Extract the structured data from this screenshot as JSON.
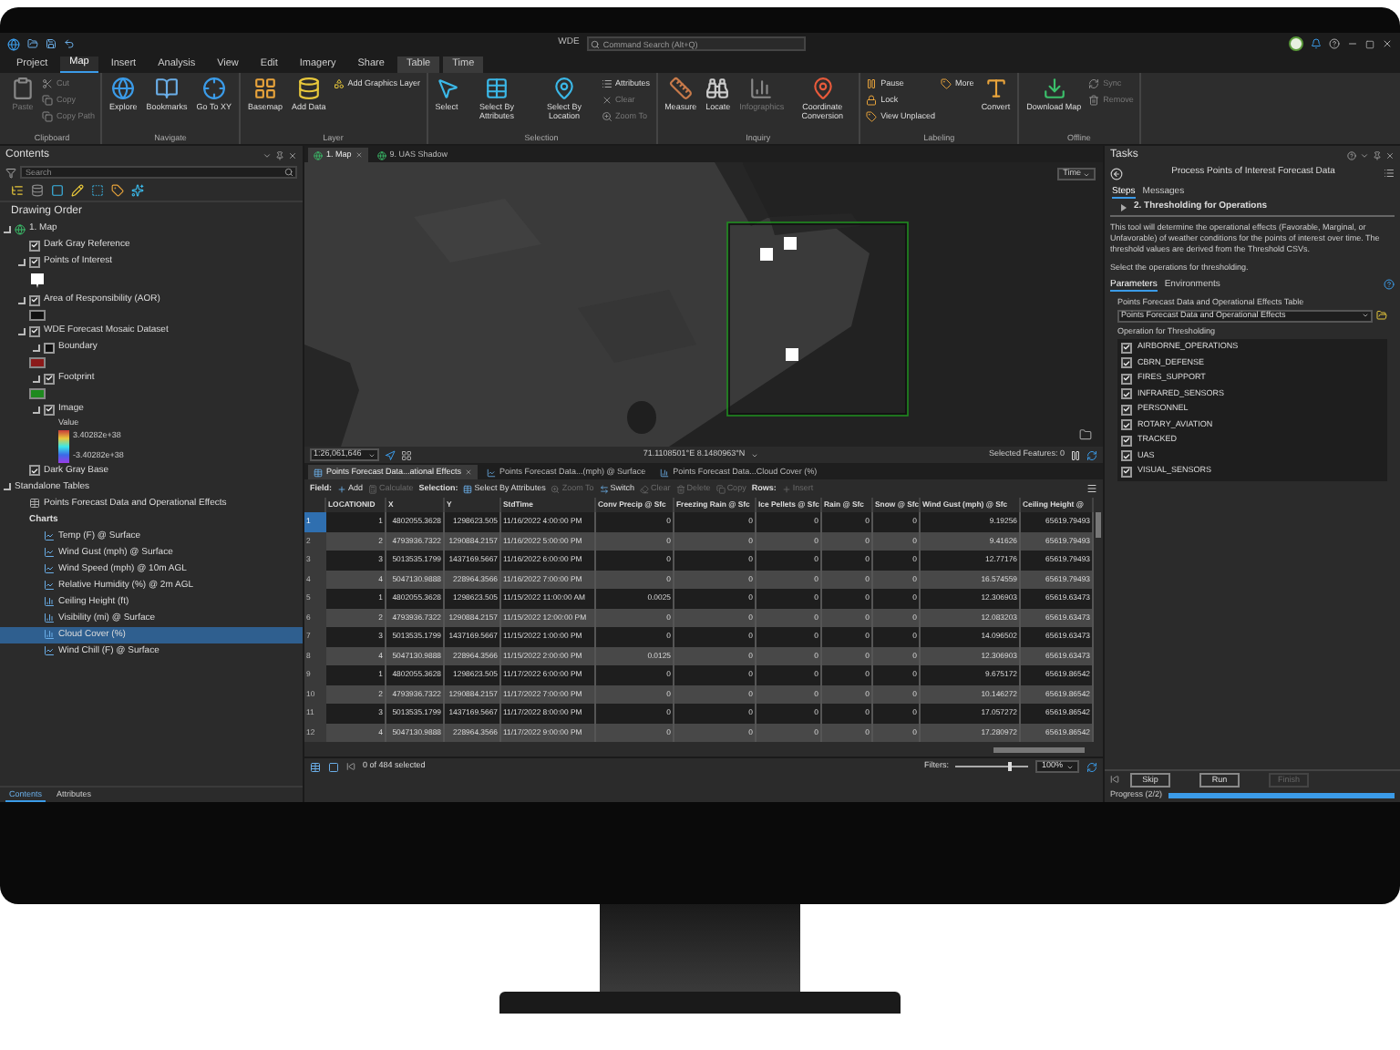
{
  "title_bar": {
    "app_title": "WDE",
    "search_placeholder": "Command Search (Alt+Q)"
  },
  "ribbon_tabs": [
    {
      "label": "Project",
      "selected": false,
      "kind": "plain"
    },
    {
      "label": "Map",
      "selected": true,
      "kind": "plain"
    },
    {
      "label": "Insert",
      "selected": false,
      "kind": "plain"
    },
    {
      "label": "Analysis",
      "selected": false,
      "kind": "plain"
    },
    {
      "label": "View",
      "selected": false,
      "kind": "plain"
    },
    {
      "label": "Edit",
      "selected": false,
      "kind": "plain"
    },
    {
      "label": "Imagery",
      "selected": false,
      "kind": "plain"
    },
    {
      "label": "Share",
      "selected": false,
      "kind": "plain"
    },
    {
      "label": "Table",
      "selected": false,
      "kind": "contextual"
    },
    {
      "label": "Time",
      "selected": false,
      "kind": "contextual"
    }
  ],
  "ribbon_groups": [
    {
      "title": "Clipboard",
      "items": [
        {
          "label": "Paste",
          "kind": "large",
          "disabled": true
        },
        {
          "label": "Cut",
          "kind": "small",
          "disabled": true
        },
        {
          "label": "Copy",
          "kind": "small",
          "disabled": true
        },
        {
          "label": "Copy Path",
          "kind": "small",
          "disabled": true
        }
      ]
    },
    {
      "title": "Navigate",
      "items": [
        {
          "label": "Explore",
          "kind": "large",
          "disabled": false
        },
        {
          "label": "Bookmarks",
          "kind": "large",
          "disabled": false
        },
        {
          "label": "Go To XY",
          "kind": "large",
          "disabled": false
        }
      ]
    },
    {
      "title": "Layer",
      "items": [
        {
          "label": "Basemap",
          "kind": "large",
          "disabled": false
        },
        {
          "label": "Add Data",
          "kind": "large",
          "disabled": false
        },
        {
          "label": "Add Graphics Layer",
          "kind": "small",
          "disabled": false
        }
      ]
    },
    {
      "title": "Selection",
      "items": [
        {
          "label": "Select",
          "kind": "large",
          "disabled": false
        },
        {
          "label": "Select By Attributes",
          "kind": "large",
          "disabled": false
        },
        {
          "label": "Select By Location",
          "kind": "large",
          "disabled": false
        },
        {
          "label": "Attributes",
          "kind": "small",
          "disabled": false
        },
        {
          "label": "Clear",
          "kind": "small",
          "disabled": true
        },
        {
          "label": "Zoom To",
          "kind": "small",
          "disabled": true
        }
      ]
    },
    {
      "title": "Inquiry",
      "items": [
        {
          "label": "Measure",
          "kind": "large",
          "disabled": false
        },
        {
          "label": "Locate",
          "kind": "large",
          "disabled": false
        },
        {
          "label": "Infographics",
          "kind": "large",
          "disabled": true
        },
        {
          "label": "Coordinate Conversion",
          "kind": "large",
          "disabled": false
        }
      ]
    },
    {
      "title": "Labeling",
      "items": [
        {
          "label": "Pause",
          "kind": "small",
          "disabled": false
        },
        {
          "label": "Lock",
          "kind": "small",
          "disabled": false
        },
        {
          "label": "View Unplaced",
          "kind": "small",
          "disabled": false
        },
        {
          "label": "More",
          "kind": "small",
          "disabled": false
        },
        {
          "label": "Convert",
          "kind": "large",
          "disabled": false
        }
      ]
    },
    {
      "title": "Offline",
      "items": [
        {
          "label": "Download Map",
          "kind": "large",
          "disabled": false
        },
        {
          "label": "Sync",
          "kind": "small",
          "disabled": true
        },
        {
          "label": "Remove",
          "kind": "small",
          "disabled": true
        }
      ]
    }
  ],
  "contents": {
    "title": "Contents",
    "search_placeholder": "Search",
    "heading": "Drawing Order",
    "items": [
      {
        "kind": "map",
        "label": "1. Map",
        "expanded": true,
        "children": [
          {
            "kind": "layer",
            "label": "Dark Gray Reference",
            "checked": true
          },
          {
            "kind": "layer",
            "label": "Points of Interest",
            "checked": true,
            "expanded": true,
            "symbol": {
              "kind": "marker"
            }
          },
          {
            "kind": "layer",
            "label": "Area of Responsibility (AOR)",
            "checked": true,
            "expanded": true,
            "symbol": {
              "kind": "box",
              "color": "#111111"
            }
          },
          {
            "kind": "layer",
            "label": "WDE Forecast Mosaic Dataset",
            "checked": true,
            "expanded": true,
            "children": [
              {
                "kind": "layer",
                "label": "Boundary",
                "checked": false,
                "expanded": true,
                "symbol": {
                  "kind": "box",
                  "color": "#8b1a1a"
                }
              },
              {
                "kind": "layer",
                "label": "Footprint",
                "checked": true,
                "expanded": true,
                "symbol": {
                  "kind": "box",
                  "color": "#1f8a1f"
                }
              },
              {
                "kind": "layer",
                "label": "Image",
                "checked": true,
                "expanded": true,
                "legend": {
                  "title": "Value",
                  "high": "3.40282e+38",
                  "low": "-3.40282e+38"
                }
              }
            ]
          },
          {
            "kind": "layer",
            "label": "Dark Gray Base",
            "checked": true
          }
        ]
      },
      {
        "kind": "group",
        "label": "Standalone Tables",
        "expanded": true,
        "children": [
          {
            "kind": "table",
            "label": "Points Forecast Data and Operational Effects"
          },
          {
            "kind": "heading",
            "label": "Charts",
            "children": [
              {
                "kind": "line_chart",
                "label": "Temp (F) @ Surface",
                "selected": false
              },
              {
                "kind": "line_chart",
                "label": "Wind Gust (mph) @ Surface",
                "selected": false
              },
              {
                "kind": "line_chart",
                "label": "Wind Speed (mph) @ 10m AGL",
                "selected": false
              },
              {
                "kind": "line_chart",
                "label": "Relative Humidity (%) @ 2m AGL",
                "selected": false
              },
              {
                "kind": "bar_chart",
                "label": "Ceiling Height (ft)",
                "selected": false
              },
              {
                "kind": "bar_chart",
                "label": "Visibility (mi) @ Surface",
                "selected": false
              },
              {
                "kind": "bar_chart",
                "label": "Cloud Cover (%)",
                "selected": true
              },
              {
                "kind": "line_chart",
                "label": "Wind Chill (F) @ Surface",
                "selected": false
              }
            ]
          }
        ]
      }
    ],
    "bottom_tabs": [
      {
        "label": "Contents",
        "selected": true
      },
      {
        "label": "Attributes",
        "selected": false
      }
    ]
  },
  "map_view": {
    "tabs": [
      {
        "label": "1. Map",
        "selected": true
      },
      {
        "label": "9. UAS Shadow",
        "selected": false
      }
    ],
    "time_button": "Time",
    "scale": "1:26,061,646",
    "coordinates": "71.1108501°E 8.1480963°N",
    "selected_features": "Selected Features: 0"
  },
  "attribute_table": {
    "tabs": [
      {
        "label": "Points Forecast Data...ational Effects",
        "kind": "table",
        "selected": true
      },
      {
        "label": "Points Forecast Data...(mph) @ Surface",
        "kind": "line_chart",
        "selected": false
      },
      {
        "label": "Points Forecast Data...Cloud Cover (%)",
        "kind": "bar_chart",
        "selected": false
      }
    ],
    "toolbar": [
      {
        "kind": "label",
        "label": "Field:"
      },
      {
        "kind": "button",
        "label": "Add",
        "disabled": false
      },
      {
        "kind": "button",
        "label": "Calculate",
        "disabled": true
      },
      {
        "kind": "label",
        "label": "Selection:"
      },
      {
        "kind": "button",
        "label": "Select By Attributes",
        "disabled": false
      },
      {
        "kind": "button",
        "label": "Zoom To",
        "disabled": true
      },
      {
        "kind": "button",
        "label": "Switch",
        "disabled": false
      },
      {
        "kind": "button",
        "label": "Clear",
        "disabled": true
      },
      {
        "kind": "button",
        "label": "Delete",
        "disabled": true
      },
      {
        "kind": "button",
        "label": "Copy",
        "disabled": true
      },
      {
        "kind": "label",
        "label": "Rows:"
      },
      {
        "kind": "button",
        "label": "Insert",
        "disabled": true
      }
    ],
    "columns": [
      "LOCATIONID",
      "X",
      "Y",
      "StdTime",
      "Conv Precip @ Sfc",
      "Freezing Rain @ Sfc",
      "Ice Pellets @ Sfc",
      "Rain @ Sfc",
      "Snow @ Sfc",
      "Wind Gust (mph) @ Sfc",
      "Ceiling Height @"
    ],
    "rows": [
      {
        "number": "1",
        "current": true,
        "cells": [
          "1",
          "4802055.3628",
          "1298623.505",
          "11/16/2022 4:00:00 PM",
          "0",
          "0",
          "0",
          "0",
          "0",
          "9.19256",
          "65619.79493"
        ]
      },
      {
        "number": "2",
        "current": false,
        "cells": [
          "2",
          "4793936.7322",
          "1290884.2157",
          "11/16/2022 5:00:00 PM",
          "0",
          "0",
          "0",
          "0",
          "0",
          "9.41626",
          "65619.79493"
        ]
      },
      {
        "number": "3",
        "current": false,
        "cells": [
          "3",
          "5013535.1799",
          "1437169.5667",
          "11/16/2022 6:00:00 PM",
          "0",
          "0",
          "0",
          "0",
          "0",
          "12.77176",
          "65619.79493"
        ]
      },
      {
        "number": "4",
        "current": false,
        "cells": [
          "4",
          "5047130.9888",
          "228964.3566",
          "11/16/2022 7:00:00 PM",
          "0",
          "0",
          "0",
          "0",
          "0",
          "16.574559",
          "65619.79493"
        ]
      },
      {
        "number": "5",
        "current": false,
        "cells": [
          "1",
          "4802055.3628",
          "1298623.505",
          "11/15/2022 11:00:00 AM",
          "0.0025",
          "0",
          "0",
          "0",
          "0",
          "12.306903",
          "65619.63473"
        ]
      },
      {
        "number": "6",
        "current": false,
        "cells": [
          "2",
          "4793936.7322",
          "1290884.2157",
          "11/15/2022 12:00:00 PM",
          "0",
          "0",
          "0",
          "0",
          "0",
          "12.083203",
          "65619.63473"
        ]
      },
      {
        "number": "7",
        "current": false,
        "cells": [
          "3",
          "5013535.1799",
          "1437169.5667",
          "11/15/2022 1:00:00 PM",
          "0",
          "0",
          "0",
          "0",
          "0",
          "14.096502",
          "65619.63473"
        ]
      },
      {
        "number": "8",
        "current": false,
        "cells": [
          "4",
          "5047130.9888",
          "228964.3566",
          "11/15/2022 2:00:00 PM",
          "0.0125",
          "0",
          "0",
          "0",
          "0",
          "12.306903",
          "65619.63473"
        ]
      },
      {
        "number": "9",
        "current": false,
        "cells": [
          "1",
          "4802055.3628",
          "1298623.505",
          "11/17/2022 6:00:00 PM",
          "0",
          "0",
          "0",
          "0",
          "0",
          "9.675172",
          "65619.86542"
        ]
      },
      {
        "number": "10",
        "current": false,
        "cells": [
          "2",
          "4793936.7322",
          "1290884.2157",
          "11/17/2022 7:00:00 PM",
          "0",
          "0",
          "0",
          "0",
          "0",
          "10.146272",
          "65619.86542"
        ]
      },
      {
        "number": "11",
        "current": false,
        "cells": [
          "3",
          "5013535.1799",
          "1437169.5667",
          "11/17/2022 8:00:00 PM",
          "0",
          "0",
          "0",
          "0",
          "0",
          "17.057272",
          "65619.86542"
        ]
      },
      {
        "number": "12",
        "current": false,
        "cells": [
          "4",
          "5047130.9888",
          "228964.3566",
          "11/17/2022 9:00:00 PM",
          "0",
          "0",
          "0",
          "0",
          "0",
          "17.280972",
          "65619.86542"
        ]
      }
    ],
    "selection_count": "0 of 484 selected",
    "filters_label": "Filters:",
    "zoom_slider": {
      "level": 0.75
    },
    "zoom": "100%"
  },
  "tasks": {
    "title": "Tasks",
    "task_name": "Process Points of Interest Forecast Data",
    "tabs": [
      {
        "label": "Steps",
        "selected": true
      },
      {
        "label": "Messages",
        "selected": false
      }
    ],
    "step": "2. Thresholding for Operations",
    "description": "This tool will determine the operational effects (Favorable, Marginal, or Unfavorable) of weather conditions for the points of interest over time. The threshold values are derived from the Threshold CSVs.",
    "instruction": "Select the operations for thresholding.",
    "param_tabs": [
      {
        "label": "Parameters",
        "selected": true
      },
      {
        "label": "Environments",
        "selected": false
      }
    ],
    "table_label": "Points Forecast Data and Operational Effects Table",
    "table_value": "Points Forecast Data and Operational Effects",
    "operations_label": "Operation for Thresholding",
    "operations": [
      {
        "label": "AIRBORNE_OPERATIONS",
        "checked": true
      },
      {
        "label": "CBRN_DEFENSE",
        "checked": true
      },
      {
        "label": "FIRES_SUPPORT",
        "checked": true
      },
      {
        "label": "INFRARED_SENSORS",
        "checked": true
      },
      {
        "label": "PERSONNEL",
        "checked": true
      },
      {
        "label": "ROTARY_AVIATION",
        "checked": true
      },
      {
        "label": "TRACKED",
        "checked": true
      },
      {
        "label": "UAS",
        "checked": true
      },
      {
        "label": "VISUAL_SENSORS",
        "checked": true
      }
    ],
    "buttons": [
      {
        "label": "Skip",
        "disabled": false
      },
      {
        "label": "Run",
        "disabled": false
      },
      {
        "label": "Finish",
        "disabled": true
      }
    ],
    "progress_label": "Progress (2/2)",
    "progress": {
      "level": 1
    }
  }
}
